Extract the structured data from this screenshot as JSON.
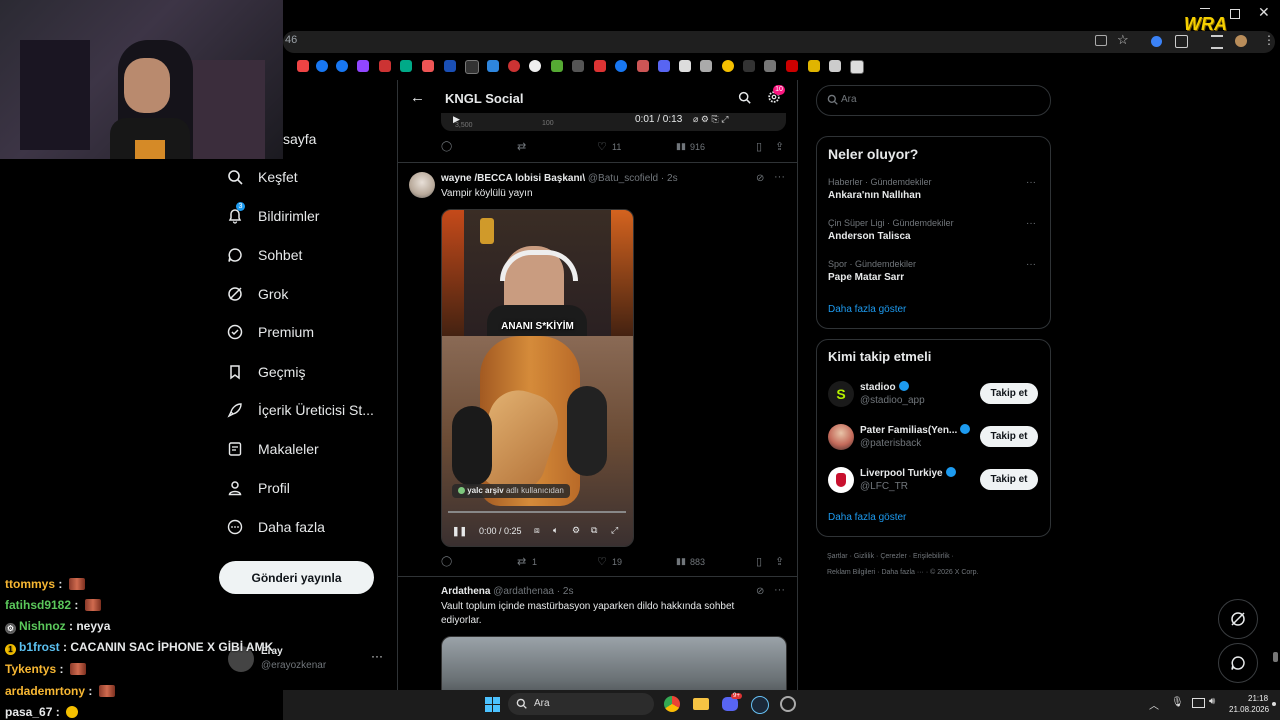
{
  "browser": {
    "address_fragment": "46",
    "extension_badge": "WRA"
  },
  "chat": [
    {
      "user": "ttommys",
      "text": "",
      "color": "#f7b733",
      "emote": true,
      "badge": ""
    },
    {
      "user": "fatihsd9182",
      "text": "",
      "color": "#5bc85b",
      "emote": true,
      "badge": ""
    },
    {
      "user": "Nishnoz",
      "text": "neyya",
      "color": "#5bc85b",
      "emote": false,
      "badge": "gear"
    },
    {
      "user": "b1frost",
      "text": "CACANIN SAC İPHONE X GİBİ AMK",
      "color": "#5bc0f0",
      "emote": false,
      "badge": "1"
    },
    {
      "user": "Tykentys",
      "text": "",
      "color": "#f7b733",
      "emote": true,
      "badge": ""
    },
    {
      "user": "ardademrtony",
      "text": "",
      "color": "#f7b733",
      "emote": true,
      "badge": ""
    },
    {
      "user": "pasa_67",
      "text": "",
      "color": "#e7e9ea",
      "emote": true,
      "badge": ""
    }
  ],
  "nav": {
    "home_partial": "sayfa",
    "items": [
      {
        "label": "Keşfet",
        "icon": "search-icon"
      },
      {
        "label": "Bildirimler",
        "icon": "bell-icon"
      },
      {
        "label": "Sohbet",
        "icon": "chat-icon"
      },
      {
        "label": "Grok",
        "icon": "grok-icon"
      },
      {
        "label": "Premium",
        "icon": "premium-icon"
      },
      {
        "label": "Geçmiş",
        "icon": "bookmark-icon"
      },
      {
        "label": "İçerik Üreticisi St...",
        "icon": "rocket-icon"
      },
      {
        "label": "Makaleler",
        "icon": "article-icon"
      },
      {
        "label": "Profil",
        "icon": "person-icon"
      },
      {
        "label": "Daha fazla",
        "icon": "more-circle-icon"
      }
    ],
    "notifications_badge": "3",
    "post_button": "Gönderi yayınla",
    "account": {
      "name": "Eray",
      "handle": "@erayozkenar"
    }
  },
  "column": {
    "title": "KNGL Social",
    "settings_badge": "10",
    "top_video": {
      "time": "0:01 / 0:13",
      "label_a": "3,500",
      "label_b": "100"
    },
    "top_stats": {
      "likes": "11",
      "views": "916"
    },
    "post1": {
      "author": "wayne /BECCA lobisi Başkanı\\",
      "handle": "@Batu_scofield",
      "age": "2s",
      "text": "Vampir köylülü yayın",
      "caption": "ANANI S*KİYİM",
      "attribution_user": "yalc arşiv",
      "attribution_rest": "adlı kullanıcıdan",
      "video_time": "0:00 / 0:25",
      "retweets": "1",
      "likes": "19",
      "views": "883"
    },
    "post2": {
      "author": "Ardathena",
      "handle": "@ardathenaa",
      "age": "2s",
      "text": "Vault toplum içinde mastürbasyon yaparken dildo hakkında sohbet ediyorlar."
    }
  },
  "search": {
    "placeholder": "Ara"
  },
  "trends": {
    "title": "Neler oluyor?",
    "items": [
      {
        "category": "Haberler · Gündemdekiler",
        "name": "Ankara'nın Nallıhan"
      },
      {
        "category": "Çin Süper Ligi · Gündemdekiler",
        "name": "Anderson Talisca"
      },
      {
        "category": "Spor · Gündemdekiler",
        "name": "Pape Matar Sarr"
      }
    ],
    "show_more": "Daha fazla göster"
  },
  "who_to_follow": {
    "title": "Kimi takip etmeli",
    "items": [
      {
        "name": "stadioo",
        "handle": "@stadioo_app",
        "button": "Takip et",
        "avatar_color": "#1a1a1a"
      },
      {
        "name": "Pater Familias(Yen...",
        "handle": "@paterisback",
        "button": "Takip et",
        "avatar_color": "#c46a5a"
      },
      {
        "name": "Liverpool Turkiye",
        "handle": "@LFC_TR",
        "button": "Takip et",
        "avatar_color": "#ffffff"
      }
    ],
    "show_more": "Daha fazla göster"
  },
  "footer": {
    "links_row1": [
      "Şartlar",
      "Gizlilik",
      "Çerezler",
      "Erişilebilirlik"
    ],
    "links_row2": [
      "Reklam Bilgileri",
      "Daha fazla ···",
      "© 2026 X Corp."
    ]
  },
  "taskbar": {
    "search_placeholder": "Ara",
    "time": "21:18",
    "date": "21.08.2026",
    "discord_badge": "9+"
  },
  "colors": {
    "accent": "#1d9bf0",
    "bg": "#000000",
    "border": "#2f3336",
    "notif": "#f91880"
  }
}
